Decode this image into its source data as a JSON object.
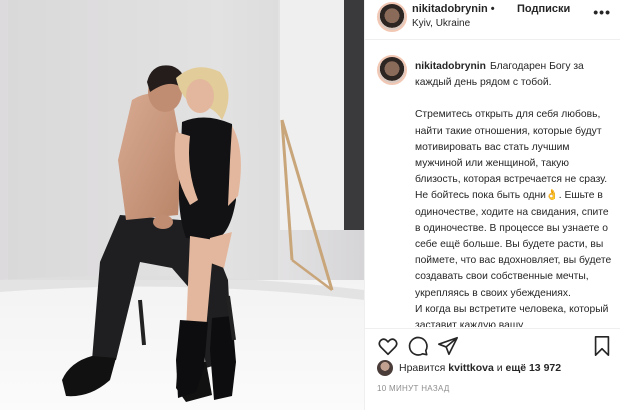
{
  "post": {
    "username": "nikitadobrynin",
    "separator": "•",
    "follow_label": "Подписки",
    "location": "Kyiv, Ukraine",
    "more_icon": "more-horizontal-icon"
  },
  "caption": {
    "username": "nikitadobrynin",
    "first_line": "Благодарен Богу за каждый день рядом с тобой.",
    "para1": "Стремитесь открыть для себя любовь, найти такие отношения, которые будут мотивировать вас стать лучшим мужчиной или женщиной, такую близость, которая встречается не сразу.",
    "para2": "Не бойтесь пока быть одни👌. Ешьте в одиночестве, ходите на свидания, спите в одиночестве. В процессе вы узнаете о себе ещё больше. Вы будете расти, вы поймете, что вас вдохновляет, вы будете создавать свои собственные мечты, укрепляясь в своих убеждениях.",
    "para3": "И когда вы встретите человека, который заставит каждую вашу"
  },
  "actions": {
    "like_icon": "heart-icon",
    "comment_icon": "comment-icon",
    "share_icon": "share-icon",
    "save_icon": "bookmark-icon"
  },
  "likes": {
    "prefix": "Нравится",
    "user": "kvittkova",
    "joiner": "и",
    "count": "ещё 13 972"
  },
  "timestamp": "10 МИНУТ НАЗАД",
  "colors": {
    "text": "#262626",
    "muted": "#8e8e8e",
    "border": "#efefef",
    "studio_wall": "#e9e8e9"
  }
}
